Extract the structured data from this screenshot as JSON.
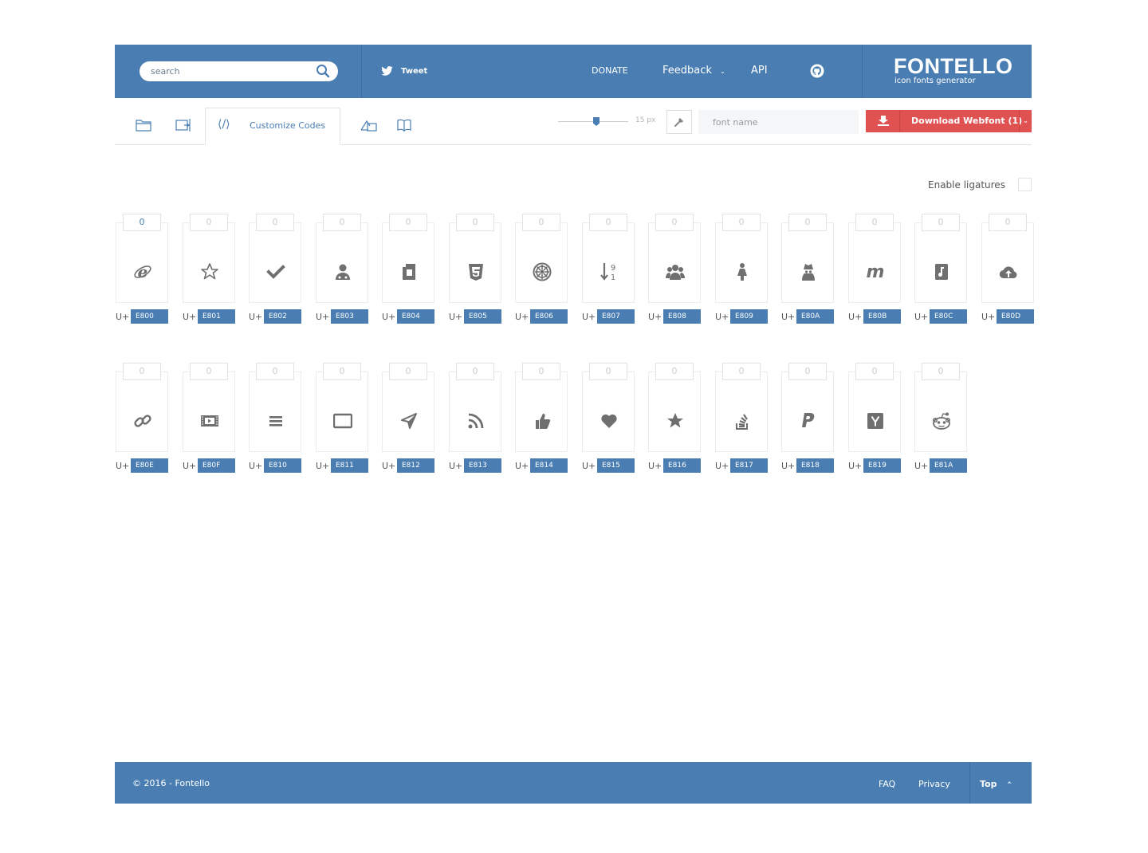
{
  "header": {
    "search_placeholder": "search",
    "tweet_label": "Tweet",
    "donate_label": "DONATE",
    "feedback_label": "Feedback",
    "api_label": "API",
    "logo_title": "FONTELLO",
    "logo_subtitle": "icon fonts generator"
  },
  "toolbar": {
    "customize_codes_label": "Customize Codes",
    "size_label": "15 px",
    "font_name_placeholder": "font name",
    "download_label": "Download Webfont (1)"
  },
  "ligatures": {
    "label": "Enable ligatures"
  },
  "code_prefix": "U+",
  "glyphs": [
    {
      "count": "0",
      "code": "E800",
      "icon": "internet-explorer-icon",
      "active": true
    },
    {
      "count": "0",
      "code": "E801",
      "icon": "star-outline-icon"
    },
    {
      "count": "0",
      "code": "E802",
      "icon": "checkmark-icon"
    },
    {
      "count": "0",
      "code": "E803",
      "icon": "user-doctor-icon"
    },
    {
      "count": "0",
      "code": "E804",
      "icon": "quote-icon"
    },
    {
      "count": "0",
      "code": "E805",
      "icon": "css3-icon"
    },
    {
      "count": "0",
      "code": "E806",
      "icon": "empire-icon"
    },
    {
      "count": "0",
      "code": "E807",
      "icon": "sort-numeric-desc-icon"
    },
    {
      "count": "0",
      "code": "E808",
      "icon": "users-icon"
    },
    {
      "count": "0",
      "code": "E809",
      "icon": "female-icon"
    },
    {
      "count": "0",
      "code": "E80A",
      "icon": "user-secret-icon"
    },
    {
      "count": "0",
      "code": "E80B",
      "icon": "mixcloud-icon"
    },
    {
      "count": "0",
      "code": "E80C",
      "icon": "music-file-icon"
    },
    {
      "count": "0",
      "code": "E80D",
      "icon": "cloud-upload-icon"
    },
    {
      "count": "0",
      "code": "E80E",
      "icon": "link-icon"
    },
    {
      "count": "0",
      "code": "E80F",
      "icon": "ticket-icon"
    },
    {
      "count": "0",
      "code": "E810",
      "icon": "menu-icon"
    },
    {
      "count": "0",
      "code": "E811",
      "icon": "tablet-icon"
    },
    {
      "count": "0",
      "code": "E812",
      "icon": "navigation-icon"
    },
    {
      "count": "0",
      "code": "E813",
      "icon": "rss-icon"
    },
    {
      "count": "0",
      "code": "E814",
      "icon": "thumbs-up-icon"
    },
    {
      "count": "0",
      "code": "E815",
      "icon": "heart-icon"
    },
    {
      "count": "0",
      "code": "E816",
      "icon": "star-icon"
    },
    {
      "count": "0",
      "code": "E817",
      "icon": "stackoverflow-icon"
    },
    {
      "count": "0",
      "code": "E818",
      "icon": "paypal-icon"
    },
    {
      "count": "0",
      "code": "E819",
      "icon": "ycombinator-icon"
    },
    {
      "count": "0",
      "code": "E81A",
      "icon": "reddit-icon"
    }
  ],
  "footer": {
    "copyright": "© 2016 - Fontello",
    "faq_label": "FAQ",
    "privacy_label": "Privacy",
    "top_label": "Top"
  },
  "colors": {
    "brand": "#4a7eb3",
    "download": "#e05252",
    "icon": "#6f6f6f"
  }
}
